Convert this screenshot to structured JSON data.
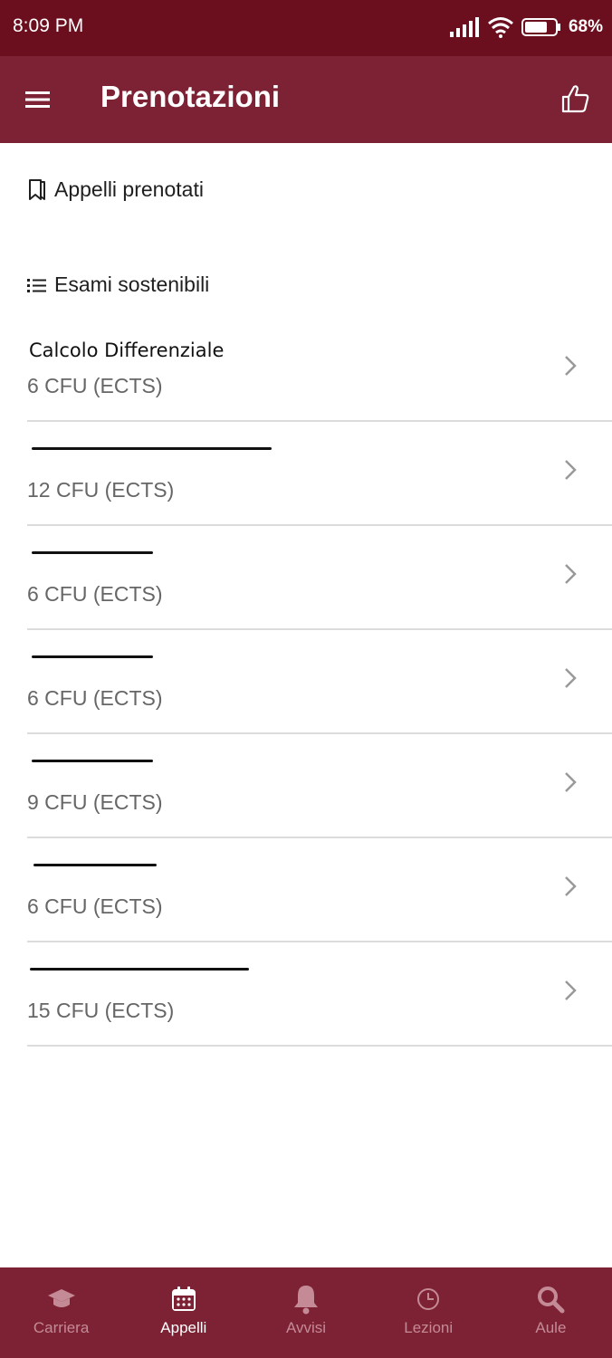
{
  "status_bar": {
    "time": "8:09 PM",
    "battery": "68%"
  },
  "app_bar": {
    "title": "Prenotazioni"
  },
  "sections": {
    "booked": "Appelli prenotati",
    "exams": "Esami sostenibili"
  },
  "exams": [
    {
      "title": "Calcolo Differenziale",
      "cfu": "6 CFU (ECTS)",
      "redacted": false
    },
    {
      "title": "",
      "cfu": "12 CFU (ECTS)",
      "redacted": true
    },
    {
      "title": "",
      "cfu": "6 CFU (ECTS)",
      "redacted": true
    },
    {
      "title": "",
      "cfu": "6 CFU (ECTS)",
      "redacted": true
    },
    {
      "title": "",
      "cfu": "9 CFU (ECTS)",
      "redacted": true
    },
    {
      "title": "",
      "cfu": "6 CFU (ECTS)",
      "redacted": true
    },
    {
      "title": "",
      "cfu": "15 CFU (ECTS)",
      "redacted": true
    }
  ],
  "bottom_nav": [
    {
      "label": "Carriera",
      "icon": "graduation-cap-icon",
      "active": false
    },
    {
      "label": "Appelli",
      "icon": "calendar-icon",
      "active": true
    },
    {
      "label": "Avvisi",
      "icon": "bell-icon",
      "active": false
    },
    {
      "label": "Lezioni",
      "icon": "clock-icon",
      "active": false
    },
    {
      "label": "Aule",
      "icon": "search-icon",
      "active": false
    }
  ],
  "colors": {
    "status_bar": "#6b0f1f",
    "app_bar": "#7d2234",
    "nav_inactive": "#c48a96"
  }
}
